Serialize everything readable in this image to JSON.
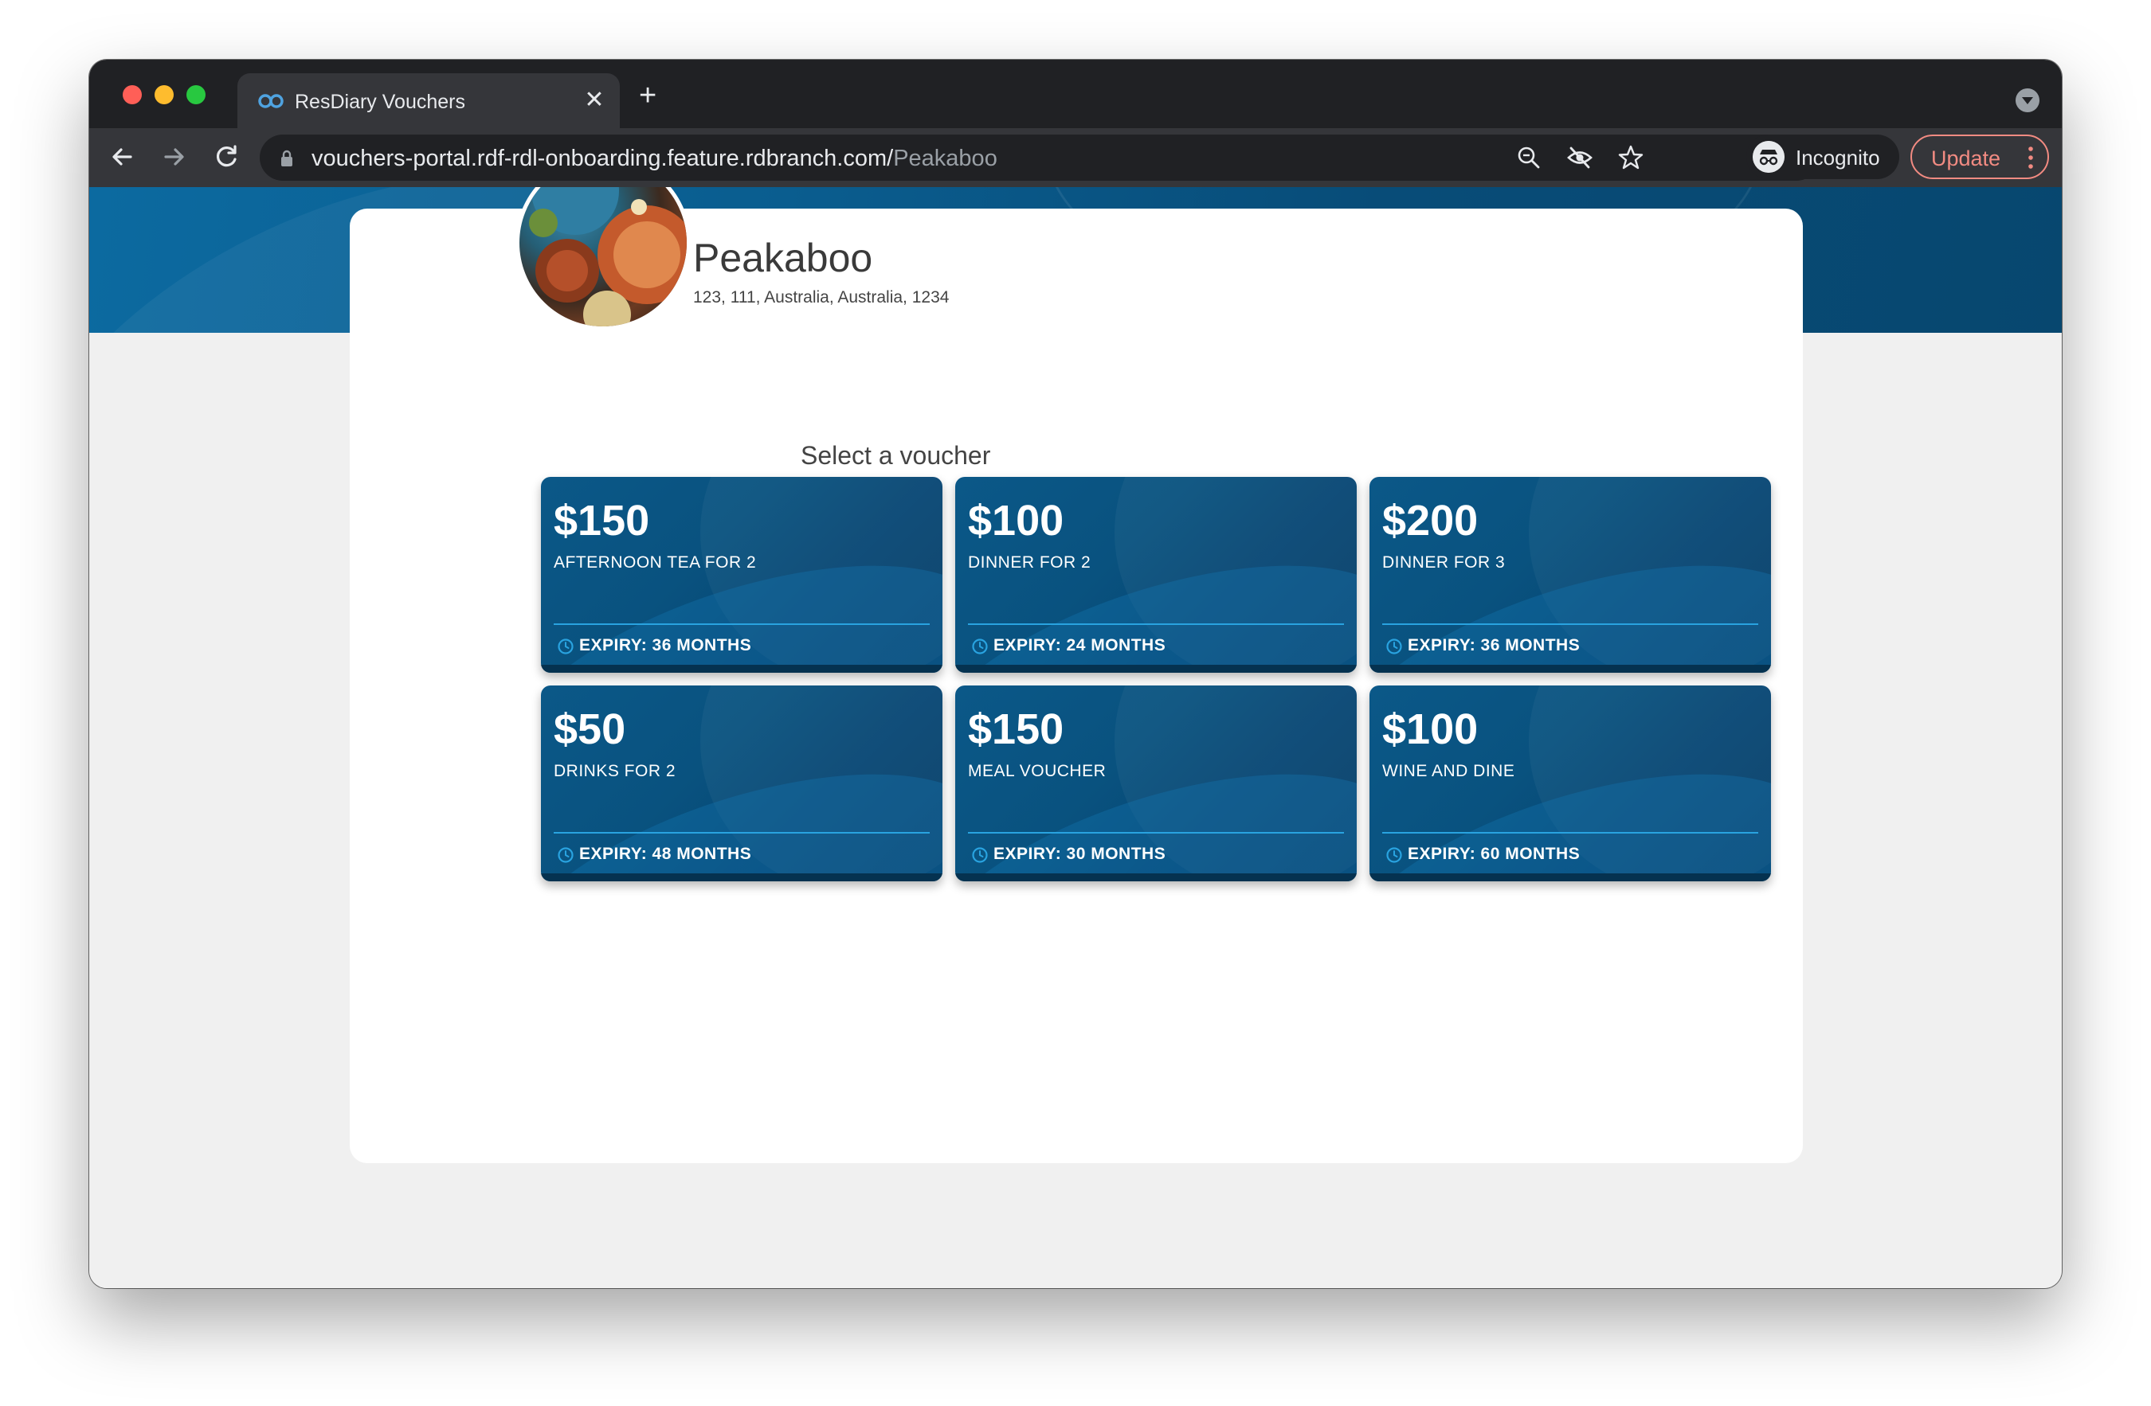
{
  "browser": {
    "tab_title": "ResDiary Vouchers",
    "new_tab_symbol": "+",
    "close_symbol": "✕",
    "url_host": "vouchers-portal.rdf-rdl-onboarding.feature.rdbranch.com/",
    "url_path": "Peakaboo",
    "incognito_label": "Incognito",
    "update_label": "Update",
    "icons": [
      "back-icon",
      "forward-icon",
      "reload-icon",
      "lock-icon",
      "zoom-icon",
      "eye-off-icon",
      "star-icon",
      "incognito-icon",
      "more-vert-icon",
      "tab-search-icon"
    ]
  },
  "venue": {
    "name": "Peakaboo",
    "address": "123, 111, Australia, Australia, 1234"
  },
  "section_title": "Select a voucher",
  "vouchers": [
    {
      "amount": "$150",
      "description": "AFTERNOON TEA FOR 2",
      "expiry": "EXPIRY: 36 MONTHS"
    },
    {
      "amount": "$100",
      "description": "DINNER FOR 2",
      "expiry": "EXPIRY: 24 MONTHS"
    },
    {
      "amount": "$200",
      "description": "DINNER FOR 3",
      "expiry": "EXPIRY: 36 MONTHS"
    },
    {
      "amount": "$50",
      "description": "DRINKS FOR 2",
      "expiry": "EXPIRY: 48 MONTHS"
    },
    {
      "amount": "$150",
      "description": "MEAL VOUCHER",
      "expiry": "EXPIRY: 30 MONTHS"
    },
    {
      "amount": "$100",
      "description": "WINE AND DINE",
      "expiry": "EXPIRY: 60 MONTHS"
    }
  ],
  "colors": {
    "brand_blue": "#0a5d8f",
    "accent_line": "#29a3e0",
    "update_red": "#f28b82"
  }
}
